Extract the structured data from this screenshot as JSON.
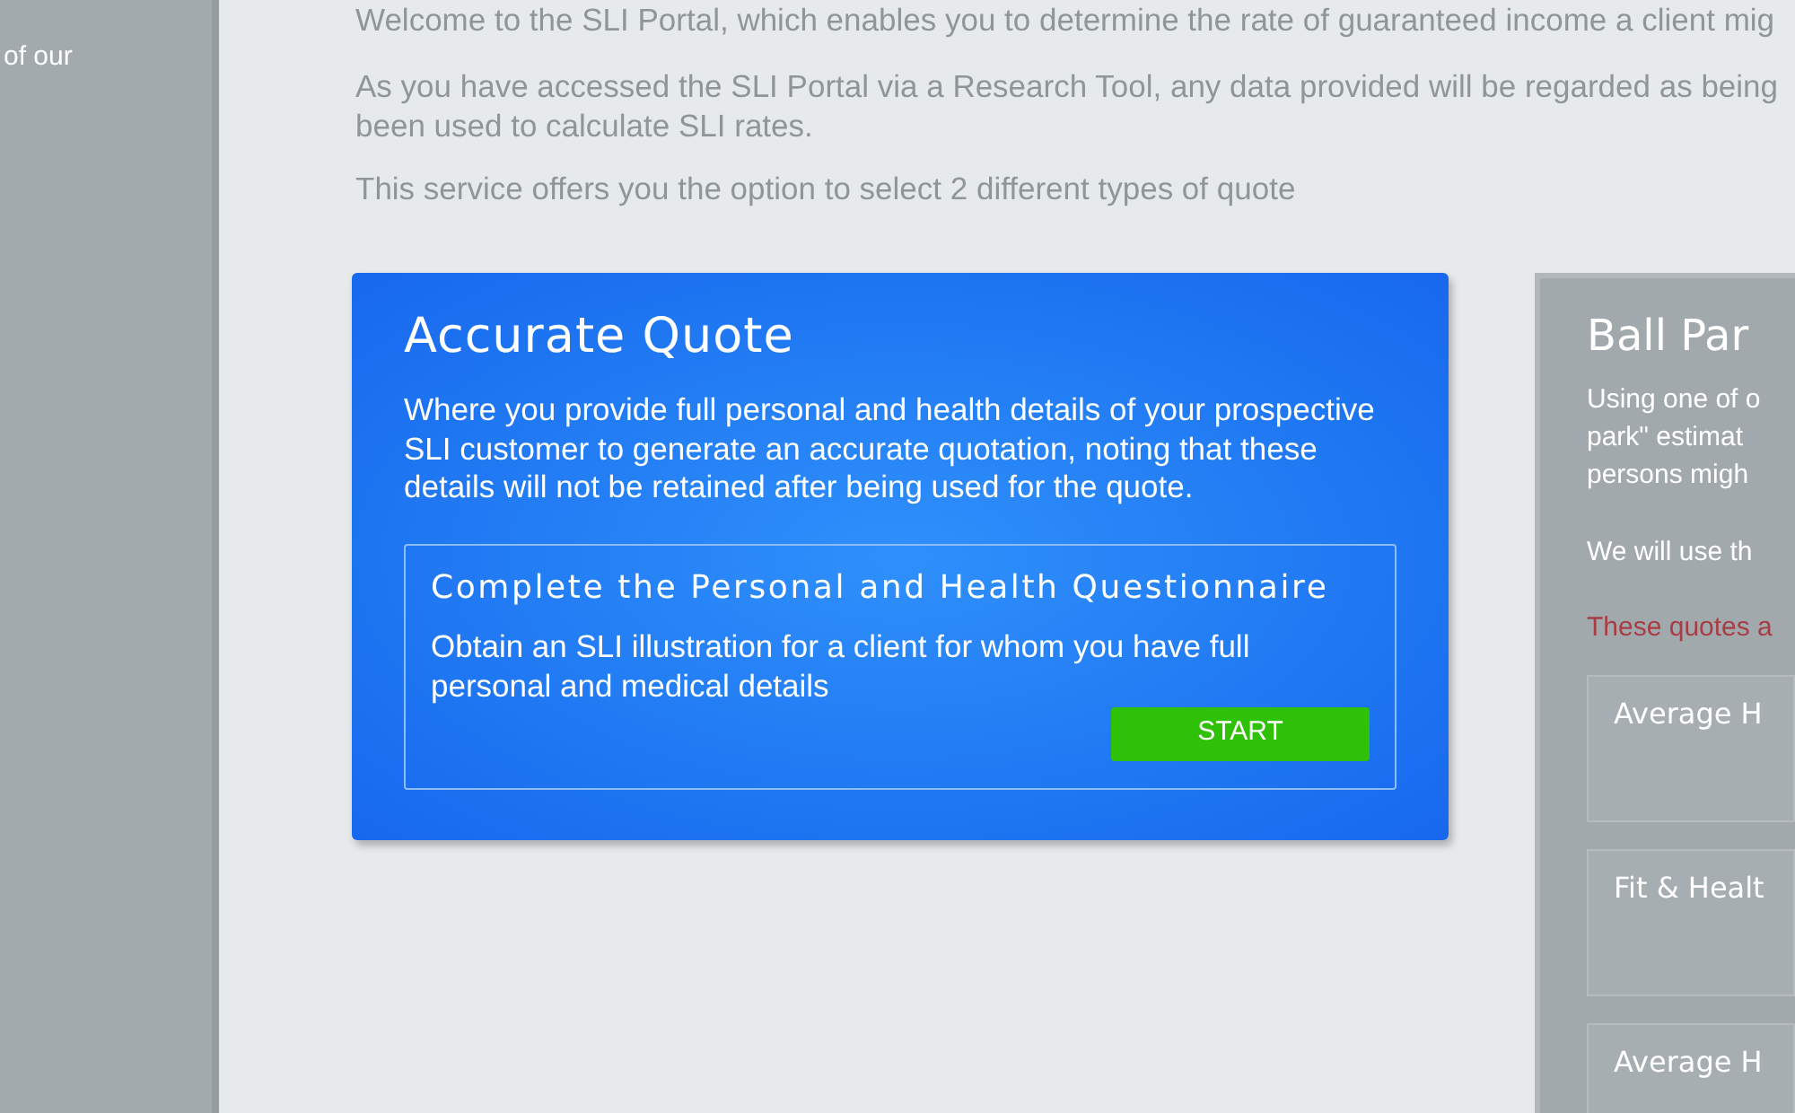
{
  "sidebar": {
    "text": "of our"
  },
  "intro": [
    {
      "lines": [
        "Welcome to the SLI Portal, which enables you to determine the rate of guaranteed income a client mig"
      ]
    },
    {
      "lines": [
        "As you have accessed the SLI Portal via a Research Tool, any data provided will be regarded as being",
        "been used to calculate SLI rates."
      ]
    },
    {
      "lines": [
        "This service offers you the option to select 2 different types of quote"
      ]
    }
  ],
  "accurate_quote": {
    "title": "Accurate Quote",
    "description": "Where you provide full personal and health details of your prospective SLI customer to generate an accurate quotation, noting that these details will not be retained after being used for the quote.",
    "questionnaire": {
      "title": "Complete the Personal and Health Questionnaire",
      "description": "Obtain an SLI illustration for a client for whom you have full personal and medical details",
      "button": "START"
    }
  },
  "ball_park": {
    "title": "Ball Par",
    "description_lines": [
      "Using one of o",
      "park\" estimat",
      "persons migh"
    ],
    "note": "We will use th",
    "warning": "These quotes a",
    "options": [
      {
        "title": "Average H"
      },
      {
        "title": "Fit & Healt"
      },
      {
        "title": "Average H"
      }
    ]
  }
}
